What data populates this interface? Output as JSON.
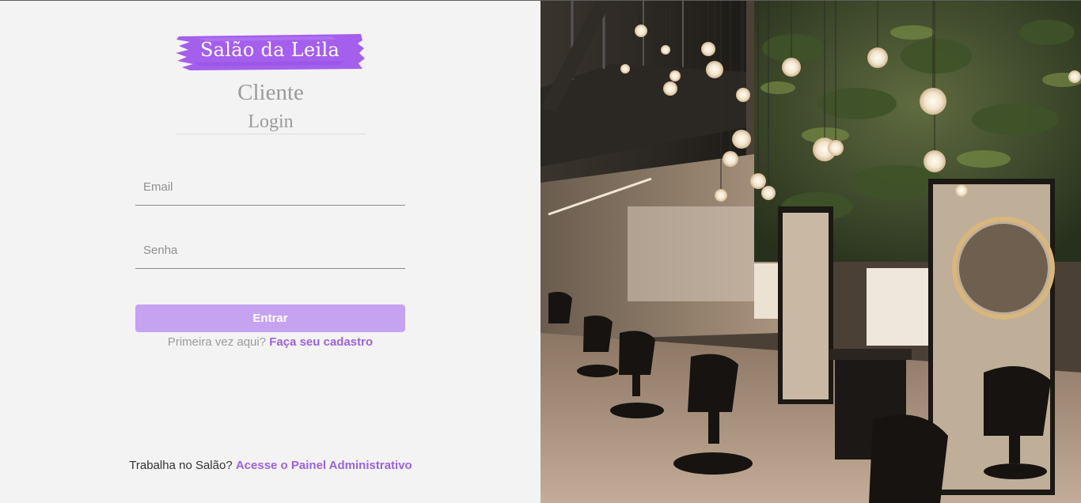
{
  "brand": {
    "name": "Salão da Leila",
    "color": "#a45fec"
  },
  "header": {
    "title": "Cliente",
    "subtitle": "Login"
  },
  "form": {
    "email": {
      "placeholder": "Email",
      "value": ""
    },
    "password": {
      "placeholder": "Senha",
      "value": ""
    },
    "submit_label": "Entrar",
    "submit_color": "#c6a3f1"
  },
  "signup": {
    "prompt": "Primeira vez aqui?",
    "link": "Faça seu cadastro"
  },
  "admin": {
    "prompt": "Trabalha no Salão?",
    "link": "Acesse o Painel Administrativo"
  },
  "accent_color": "#9b62dd",
  "hero_image": {
    "icon": "salon-interior-photo"
  }
}
